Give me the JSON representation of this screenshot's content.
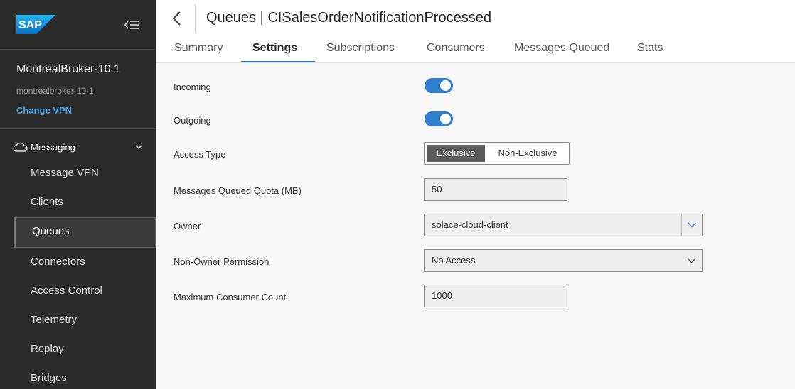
{
  "sidebar": {
    "logo_text": "SAP",
    "broker_name": "MontrealBroker-10.1",
    "broker_id": "montrealbroker-10-1",
    "change_vpn_label": "Change VPN",
    "section_label": "Messaging",
    "items": [
      {
        "label": "Message VPN"
      },
      {
        "label": "Clients"
      },
      {
        "label": "Queues"
      },
      {
        "label": "Connectors"
      },
      {
        "label": "Access Control"
      },
      {
        "label": "Telemetry"
      },
      {
        "label": "Replay"
      },
      {
        "label": "Bridges"
      }
    ],
    "active_item": "Queues"
  },
  "header": {
    "title": "Queues | CISalesOrderNotificationProcessed",
    "tabs": [
      {
        "label": "Summary"
      },
      {
        "label": "Settings"
      },
      {
        "label": "Subscriptions"
      },
      {
        "label": "Consumers"
      },
      {
        "label": "Messages Queued"
      },
      {
        "label": "Stats"
      }
    ],
    "active_tab": "Settings"
  },
  "form": {
    "incoming": {
      "label": "Incoming",
      "enabled": true
    },
    "outgoing": {
      "label": "Outgoing",
      "enabled": true
    },
    "access_type": {
      "label": "Access Type",
      "options": [
        "Exclusive",
        "Non-Exclusive"
      ],
      "selected": "Exclusive"
    },
    "quota": {
      "label": "Messages Queued Quota (MB)",
      "value": "50"
    },
    "owner": {
      "label": "Owner",
      "value": "solace-cloud-client"
    },
    "non_owner_permission": {
      "label": "Non-Owner Permission",
      "value": "No Access"
    },
    "max_consumers": {
      "label": "Maximum Consumer Count",
      "value": "1000"
    }
  },
  "colors": {
    "sidebar_bg": "#2b2b2b",
    "accent": "#2f7fd0",
    "link": "#4ba6e8",
    "tab_underline": "#2b7bc9"
  }
}
